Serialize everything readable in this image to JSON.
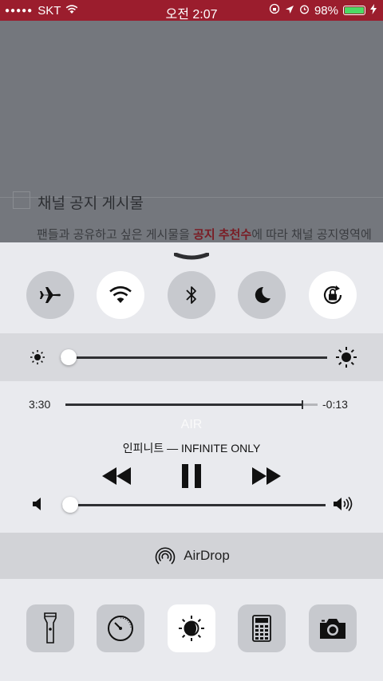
{
  "status_bar": {
    "signal_dots": "●●●●●",
    "carrier": "SKT",
    "time": "오전 2:07",
    "battery_percent": "98%",
    "battery_level": 0.98,
    "bar_color": "#9b1d2d"
  },
  "background_page": {
    "checkbox_label": "채널 공지 게시물",
    "description_prefix": "팬들과 공유하고 싶은 게시물을 ",
    "description_highlight": "공지 추천수",
    "description_suffix": "에 따라 채널 공지영역에"
  },
  "control_center": {
    "toggles": [
      {
        "name": "airplane-mode",
        "icon": "airplane-icon",
        "on": false
      },
      {
        "name": "wifi",
        "icon": "wifi-icon",
        "on": true
      },
      {
        "name": "bluetooth",
        "icon": "bluetooth-icon",
        "on": false
      },
      {
        "name": "do-not-disturb",
        "icon": "moon-icon",
        "on": false
      },
      {
        "name": "rotation-lock",
        "icon": "rotation-lock-icon",
        "on": true
      }
    ],
    "brightness_level": 0.03,
    "music": {
      "elapsed": "3:30",
      "remaining": "-0:13",
      "progress": 0.94,
      "title": "AIR",
      "artist_album": "인피니트 — INFINITE ONLY",
      "volume_level": 0.03
    },
    "airdrop_label": "AirDrop",
    "tools": [
      {
        "name": "flashlight",
        "icon": "flashlight-icon",
        "on": false
      },
      {
        "name": "timer",
        "icon": "timer-icon",
        "on": false
      },
      {
        "name": "night-shift",
        "icon": "night-shift-icon",
        "on": true
      },
      {
        "name": "calculator",
        "icon": "calculator-icon",
        "on": false
      },
      {
        "name": "camera",
        "icon": "camera-icon",
        "on": false
      }
    ]
  }
}
